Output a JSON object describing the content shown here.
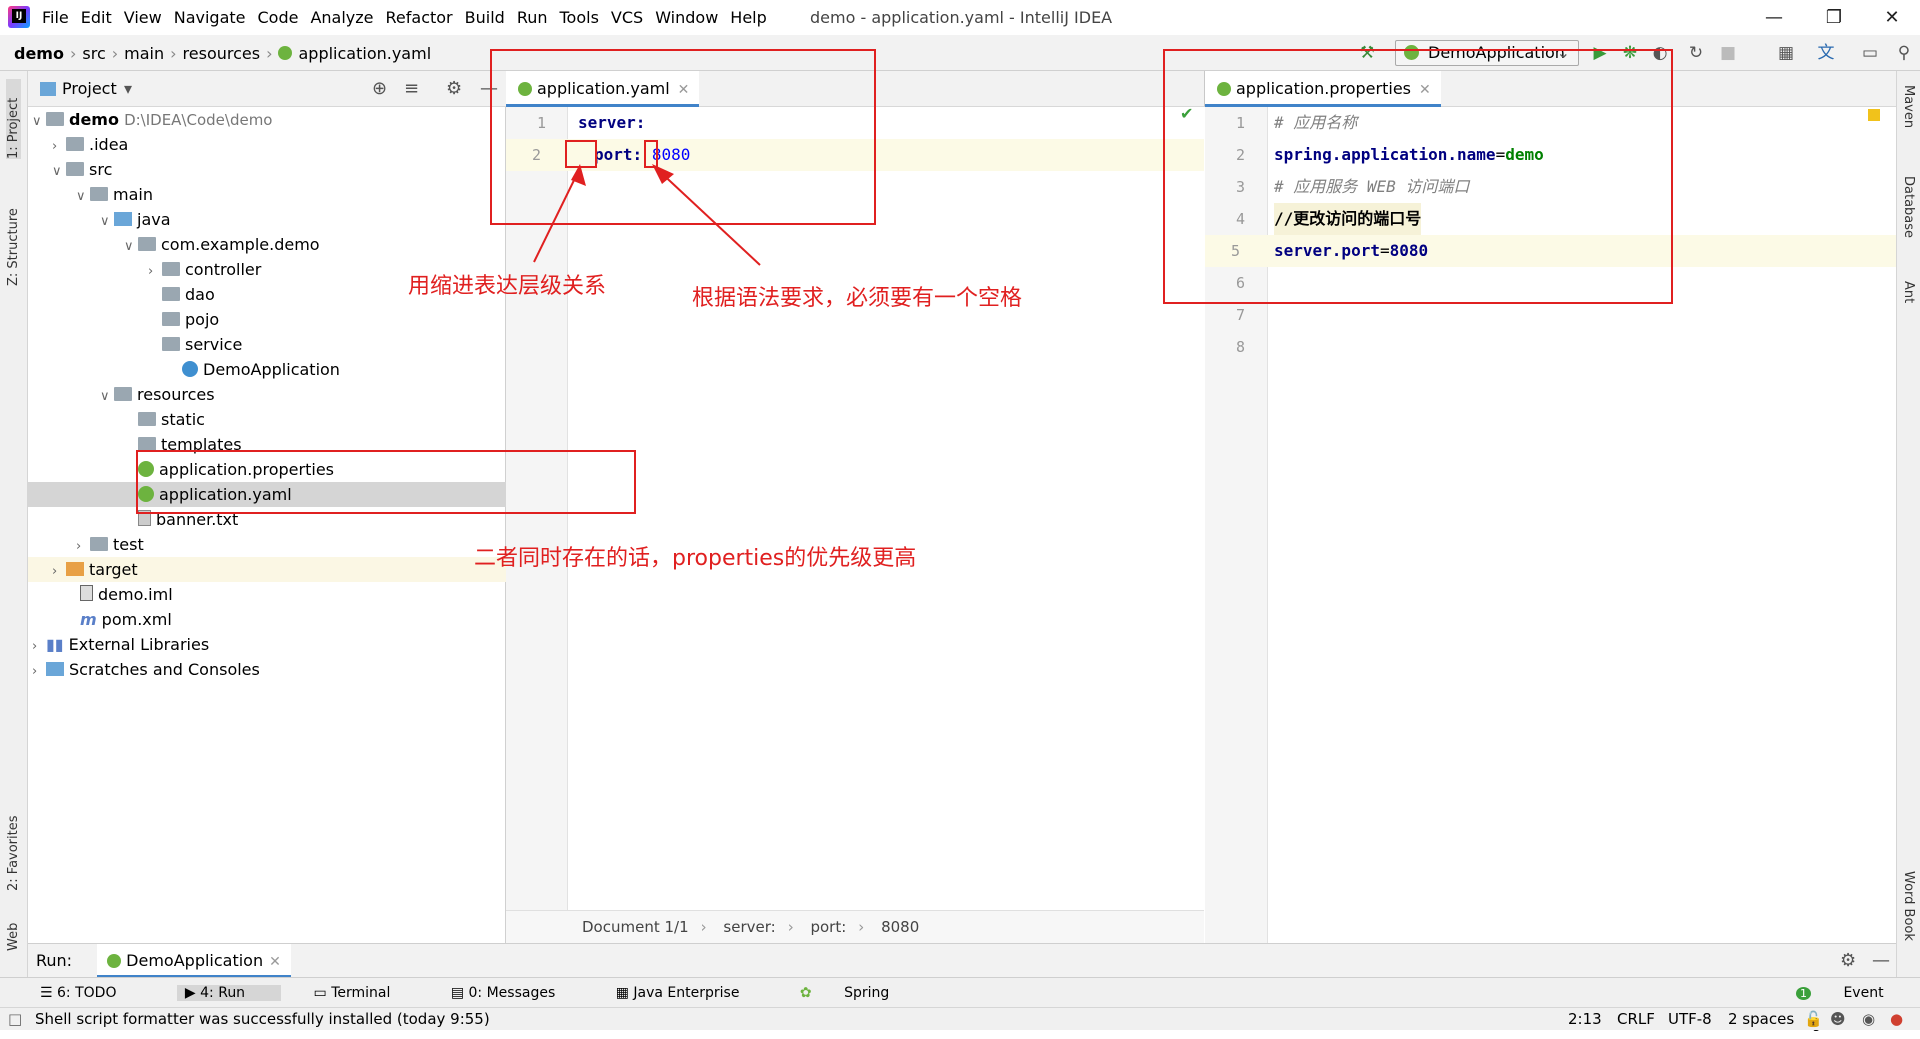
{
  "menubar": {
    "items": [
      "File",
      "Edit",
      "View",
      "Navigate",
      "Code",
      "Analyze",
      "Refactor",
      "Build",
      "Run",
      "Tools",
      "VCS",
      "Window",
      "Help"
    ],
    "title": "demo - application.yaml - IntelliJ IDEA"
  },
  "navbar": {
    "crumbs": [
      "demo",
      "src",
      "main",
      "resources",
      "application.yaml"
    ],
    "run_config": "DemoApplication"
  },
  "sidebar_left": {
    "project": "1: Project",
    "structure": "Z: Structure",
    "favorites": "2: Favorites",
    "web": "Web"
  },
  "sidebar_right": {
    "maven": "Maven",
    "database": "Database",
    "ant": "Ant",
    "wordbook": "Word Book"
  },
  "project_panel": {
    "title": "Project",
    "tree": [
      {
        "label": "demo",
        "extra": "D:\\IDEA\\Code\\demo"
      },
      {
        "label": ".idea"
      },
      {
        "label": "src"
      },
      {
        "label": "main"
      },
      {
        "label": "java"
      },
      {
        "label": "com.example.demo"
      },
      {
        "label": "controller"
      },
      {
        "label": "dao"
      },
      {
        "label": "pojo"
      },
      {
        "label": "service"
      },
      {
        "label": "DemoApplication"
      },
      {
        "label": "resources"
      },
      {
        "label": "static"
      },
      {
        "label": "templates"
      },
      {
        "label": "application.properties"
      },
      {
        "label": "application.yaml"
      },
      {
        "label": "banner.txt"
      },
      {
        "label": "test"
      },
      {
        "label": "target"
      },
      {
        "label": "demo.iml"
      },
      {
        "label": "pom.xml"
      },
      {
        "label": "External Libraries"
      },
      {
        "label": "Scratches and Consoles"
      }
    ]
  },
  "editor_yaml": {
    "tab": "application.yaml",
    "lines": [
      "1",
      "2"
    ],
    "code": {
      "l1_key": "server:",
      "l2_key": "port:",
      "l2_val": "8080"
    },
    "breadcrumbs": [
      "Document 1/1",
      "server:",
      "port:",
      "8080"
    ]
  },
  "editor_props": {
    "tab": "application.properties",
    "lines": [
      "1",
      "2",
      "3",
      "4",
      "5",
      "6",
      "7",
      "8"
    ],
    "code": {
      "l1": "# 应用名称",
      "l2_key": "spring.application.name",
      "l2_eq": "=",
      "l2_val": "demo",
      "l3": "# 应用服务 WEB 访问端口",
      "l4": "//更改访问的端口号",
      "l5_key": "server.port",
      "l5_eq": "=",
      "l5_val": "8080"
    }
  },
  "annotations": {
    "indent": "用缩进表达层级关系",
    "space": "根据语法要求，必须要有一个空格",
    "priority": "二者同时存在的话，properties的优先级更高"
  },
  "runbar": {
    "label": "Run:",
    "tab": "DemoApplication"
  },
  "toolwindows": [
    "6: TODO",
    "4: Run",
    "Terminal",
    "0: Messages",
    "Java Enterprise",
    "Spring"
  ],
  "event_log": "Event Log",
  "status": {
    "message": "Shell script formatter was successfully installed (today 9:55)",
    "position": "2:13",
    "line_sep": "CRLF",
    "encoding": "UTF-8",
    "indent": "2 spaces"
  },
  "colors": {
    "accent": "#4083c9",
    "annotation": "#e02020",
    "spring": "#6db33f"
  }
}
